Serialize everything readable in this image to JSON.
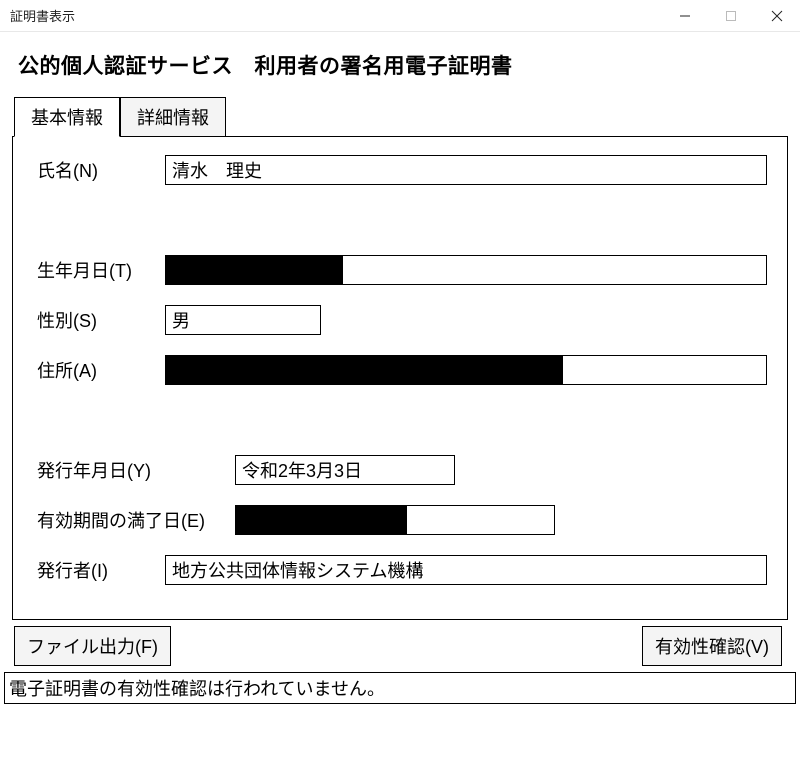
{
  "window": {
    "title": "証明書表示"
  },
  "heading": "公的個人認証サービス　利用者の署名用電子証明書",
  "tabs": {
    "basic": "基本情報",
    "detail": "詳細情報"
  },
  "fields": {
    "name_label": "氏名(N)",
    "name_value": "清水　理史",
    "dob_label": "生年月日(T)",
    "dob_value": "",
    "sex_label": "性別(S)",
    "sex_value": "男",
    "address_label": "住所(A)",
    "address_value": "",
    "issue_label": "発行年月日(Y)",
    "issue_value": "令和2年3月3日",
    "expiry_label": "有効期間の満了日(E)",
    "expiry_value": "",
    "issuer_label": "発行者(I)",
    "issuer_value": "地方公共団体情報システム機構"
  },
  "buttons": {
    "file_output": "ファイル出力(F)",
    "validity_check": "有効性確認(V)"
  },
  "status": "電子証明書の有効性確認は行われていません。"
}
